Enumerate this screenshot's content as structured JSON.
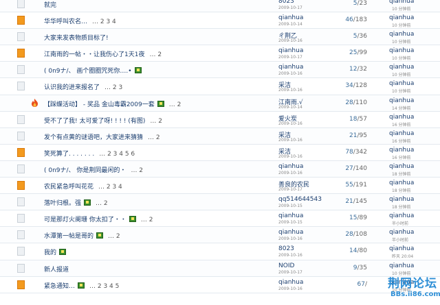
{
  "threads": [
    {
      "icon": "plain",
      "title": "就完",
      "pages": "",
      "attach": false,
      "author": "8023",
      "date": "2009-10-17",
      "replies": "5",
      "views": "23",
      "last_user": "qianhua",
      "last_time": "10 分钟前"
    },
    {
      "icon": "hot",
      "title": "华华呼叫农名…",
      "pages": "… 2 3 4",
      "attach": false,
      "author": "qianhua",
      "date": "2009-10-14",
      "replies": "46",
      "views": "183",
      "last_user": "qianhua",
      "last_time": "10 分钟前"
    },
    {
      "icon": "plain",
      "title": "大家来发表物质目标了!",
      "pages": "",
      "attach": false,
      "author": "ㄔ荆乙",
      "date": "2009-10-16",
      "replies": "5",
      "views": "36",
      "last_user": "qianhua",
      "last_time": "10 分钟前"
    },
    {
      "icon": "hot",
      "title": "江南雨的一帖・・让我伤心了1天1夜",
      "pages": "… 2",
      "attach": false,
      "author": "qianhua",
      "date": "2009-10-17",
      "replies": "25",
      "views": "99",
      "last_user": "qianhua",
      "last_time": "10 分钟前"
    },
    {
      "icon": "plain",
      "title": "( 0n9ナ/、 画个圈圈咒死你….•",
      "pages": "",
      "attach": true,
      "author": "qianhua",
      "date": "2009-10-16",
      "replies": "12",
      "views": "32",
      "last_user": "qianhua",
      "last_time": "10 分钟前"
    },
    {
      "icon": "plain",
      "title": "认识我的进来报名了",
      "pages": "… 2 3",
      "attach": false,
      "author": "采洁",
      "date": "2009-10-16",
      "replies": "34",
      "views": "128",
      "last_user": "qianhua",
      "last_time": "10 分钟前"
    },
    {
      "icon": "fire",
      "title": "【踩蝶活动】 - 奖品 金山毒霸2009一套",
      "pages": "… 2",
      "attach": true,
      "author": "江南雨.√",
      "date": "2009-10-14",
      "replies": "28",
      "views": "110",
      "last_user": "qianhua",
      "last_time": "14 分钟前"
    },
    {
      "icon": "plain",
      "title": "受不了了我! 太可爱了呀! ! ! ! (有图)",
      "pages": "… 2",
      "attach": false,
      "author": "爱火炭",
      "date": "2009-10-16",
      "replies": "18",
      "views": "57",
      "last_user": "qianhua",
      "last_time": "16 分钟前"
    },
    {
      "icon": "plain",
      "title": "发个有点黄的谜语吧，大家进来猜猜",
      "pages": "… 2",
      "attach": false,
      "author": "采洁",
      "date": "2009-10-16",
      "replies": "21",
      "views": "95",
      "last_user": "qianhua",
      "last_time": "16 分钟前"
    },
    {
      "icon": "hot",
      "title": "笑死算了. . . . . . .",
      "pages": "… 2 3 4 5 6",
      "attach": false,
      "author": "采洁",
      "date": "2009-10-16",
      "replies": "78",
      "views": "342",
      "last_user": "qianhua",
      "last_time": "16 分钟前"
    },
    {
      "icon": "plain",
      "title": "( 0n9ナ/、 你是荆同最闲的・",
      "pages": "… 2",
      "attach": false,
      "author": "qianhua",
      "date": "2009-10-16",
      "replies": "27",
      "views": "140",
      "last_user": "qianhua",
      "last_time": "18 分钟前"
    },
    {
      "icon": "hot",
      "title": "农民紧急呼叫花花",
      "pages": "… 2 3 4",
      "attach": false,
      "author": "善良的农民",
      "date": "2009-10-17",
      "replies": "55",
      "views": "191",
      "last_user": "qianhua",
      "last_time": "18 分钟前"
    },
    {
      "icon": "plain",
      "title": "落叶归根。强",
      "pages": "… 2",
      "attach": true,
      "author": "qq514644543",
      "date": "2009-10-15",
      "replies": "21",
      "views": "145",
      "last_user": "qianhua",
      "last_time": "18 分钟前"
    },
    {
      "icon": "plain",
      "title": "可是那灯火阑珊 你太扣了・・",
      "pages": "… 2",
      "attach": true,
      "author": "qianhua",
      "date": "2009-10-15",
      "replies": "15",
      "views": "89",
      "last_user": "qianhua",
      "last_time": "半小时前"
    },
    {
      "icon": "plain",
      "title": "水潭第一帖是哥的",
      "pages": "… 2",
      "attach": true,
      "author": "qianhua",
      "date": "2009-10-16",
      "replies": "28",
      "views": "108",
      "last_user": "qianhua",
      "last_time": "半小时前"
    },
    {
      "icon": "plain",
      "title": "我的",
      "pages": "",
      "attach": true,
      "author": "8023",
      "date": "2009-10-16",
      "replies": "14",
      "views": "80",
      "last_user": "qianhua",
      "last_time": "昨天 20:04"
    },
    {
      "icon": "plain",
      "title": "新人报道",
      "pages": "",
      "attach": false,
      "author": "NOID",
      "date": "2009-10-17",
      "replies": "9",
      "views": "35",
      "last_user": "qianhua",
      "last_time": "10 分钟前"
    },
    {
      "icon": "hot",
      "title": "紧急通知…",
      "pages": "… 2 3 4 5",
      "attach": true,
      "author": "qianhua",
      "date": "2009-10-16",
      "replies": "67",
      "views": "",
      "last_user": "qianhua",
      "last_time": "10 分钟前"
    }
  ],
  "watermark": {
    "title": "荆网论坛",
    "url": "BBs.ii86.com"
  },
  "colors": {
    "accent": "#2f8fd6",
    "hot_icon": "#f39a1e",
    "link": "#1a3d6e"
  }
}
